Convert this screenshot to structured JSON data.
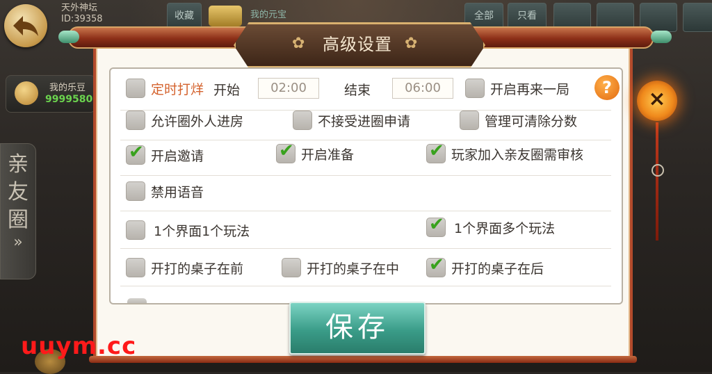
{
  "player": {
    "name": "天外神坛",
    "id": "ID:39358"
  },
  "top_buttons": {
    "share": "收藏",
    "gem": "我的元宝",
    "all": "全部",
    "only_show": "只看"
  },
  "beans": {
    "label": "我的乐豆",
    "value": "9999580"
  },
  "side_tab": {
    "label": "亲友圈",
    "arrow": "»"
  },
  "dialog": {
    "title": "高级设置"
  },
  "settings": {
    "timed": {
      "label": "定时打烊",
      "checked": false
    },
    "start_label": "开始",
    "start_time": "02:00",
    "end_label": "结束",
    "end_time": "06:00",
    "again": {
      "label": "开启再来一局",
      "checked": false
    },
    "help": "?",
    "rows": [
      [
        {
          "label": "允许圈外人进房",
          "checked": false
        },
        {
          "label": "不接受进圈申请",
          "checked": false
        },
        {
          "label": "管理可清除分数",
          "checked": false
        }
      ],
      [
        {
          "label": "开启邀请",
          "checked": true
        },
        {
          "label": "开启准备",
          "checked": true
        },
        {
          "label": "玩家加入亲友圈需审核",
          "checked": true
        }
      ],
      [
        {
          "label": "禁用语音",
          "checked": false
        }
      ],
      [
        {
          "label": "1个界面1个玩法",
          "checked": false
        },
        {
          "label": "1个界面多个玩法",
          "checked": true
        }
      ],
      [
        {
          "label": "开打的桌子在前",
          "checked": false
        },
        {
          "label": "开打的桌子在中",
          "checked": false
        },
        {
          "label": "开打的桌子在后",
          "checked": true
        }
      ]
    ]
  },
  "save_label": "保存",
  "close_label": "×",
  "watermark": "uuym.cc",
  "colors": {
    "accent_orange": "#d4622d",
    "check_green": "#39a21e",
    "save_teal": "#3a9c88",
    "frame_red": "#b24a2b"
  }
}
